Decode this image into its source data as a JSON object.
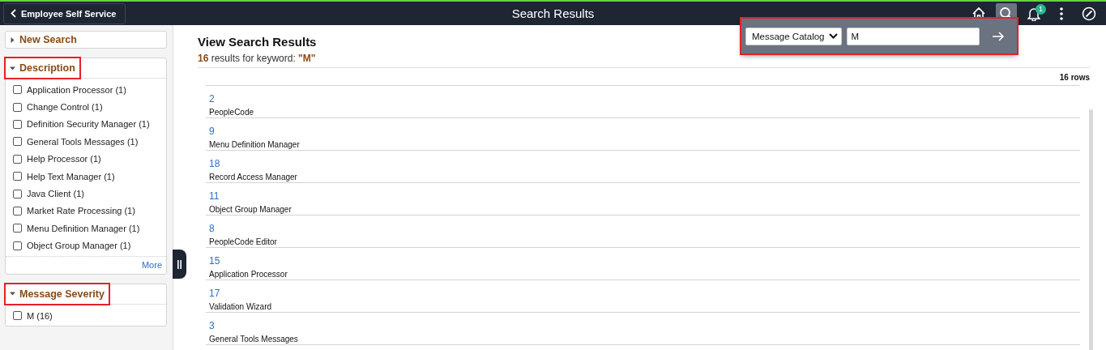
{
  "header": {
    "back_button": "Employee Self Service",
    "title": "Search Results",
    "actions": [
      {
        "kind": "home",
        "selected": false
      },
      {
        "kind": "search",
        "selected": true
      },
      {
        "kind": "bell",
        "selected": false,
        "badge": "1"
      },
      {
        "kind": "more",
        "selected": false
      },
      {
        "kind": "navigator",
        "selected": false
      }
    ]
  },
  "search_popup": {
    "highlighted": true,
    "category": "Message Catalog",
    "value": "M"
  },
  "facets": [
    {
      "title": "New Search",
      "expanded": false,
      "highlighted": false
    },
    {
      "title": "Description",
      "expanded": true,
      "highlighted": true,
      "more": "More",
      "options": [
        {
          "label": "Application Processor (1)",
          "checked": false
        },
        {
          "label": "Change Control (1)",
          "checked": false
        },
        {
          "label": "Definition Security Manager (1)",
          "checked": false
        },
        {
          "label": "General Tools Messages (1)",
          "checked": false
        },
        {
          "label": "Help Processor (1)",
          "checked": false
        },
        {
          "label": "Help Text Manager (1)",
          "checked": false
        },
        {
          "label": "Java Client (1)",
          "checked": false
        },
        {
          "label": "Market Rate Processing (1)",
          "checked": false
        },
        {
          "label": "Menu Definition Manager (1)",
          "checked": false
        },
        {
          "label": "Object Group Manager (1)",
          "checked": false
        }
      ]
    },
    {
      "title": "Message Severity",
      "expanded": true,
      "highlighted": true,
      "options": [
        {
          "label": "M (16)",
          "checked": false
        }
      ]
    }
  ],
  "results": {
    "title": "View Search Results",
    "summary": "**16** results for keyword: **\"M\"**",
    "row_count": "16 rows",
    "rows": [
      {
        "number": "2",
        "description": "PeopleCode"
      },
      {
        "number": "9",
        "description": "Menu Definition Manager"
      },
      {
        "number": "18",
        "description": "Record Access Manager"
      },
      {
        "number": "11",
        "description": "Object Group Manager"
      },
      {
        "number": "8",
        "description": "PeopleCode Editor"
      },
      {
        "number": "15",
        "description": "Application Processor"
      },
      {
        "number": "17",
        "description": "Validation Wizard"
      },
      {
        "number": "3",
        "description": "General Tools Messages"
      }
    ]
  }
}
